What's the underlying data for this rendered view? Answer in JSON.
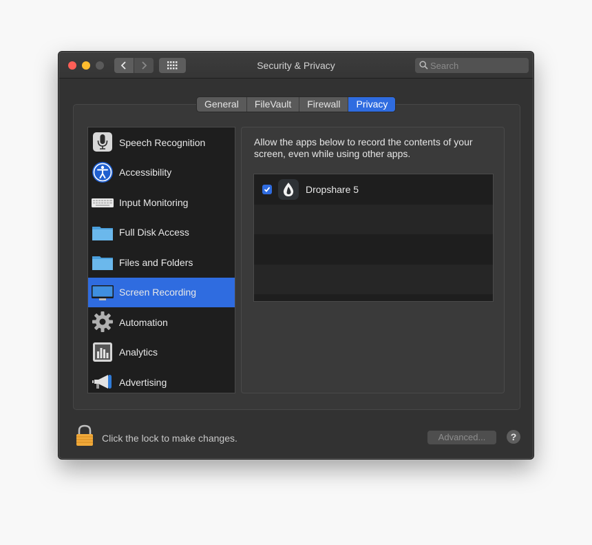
{
  "window": {
    "title": "Security & Privacy"
  },
  "toolbar": {
    "back_icon": "chevron-left-icon",
    "forward_icon": "chevron-right-icon",
    "grid_icon": "show-all-grid-icon"
  },
  "search": {
    "placeholder": "Search",
    "value": ""
  },
  "tabs": [
    {
      "label": "General",
      "active": false
    },
    {
      "label": "FileVault",
      "active": false
    },
    {
      "label": "Firewall",
      "active": false
    },
    {
      "label": "Privacy",
      "active": true
    }
  ],
  "sidebar": {
    "items": [
      {
        "label": "Speech Recognition",
        "icon": "microphone-icon",
        "selected": false
      },
      {
        "label": "Accessibility",
        "icon": "accessibility-icon",
        "selected": false
      },
      {
        "label": "Input Monitoring",
        "icon": "keyboard-icon",
        "selected": false
      },
      {
        "label": "Full Disk Access",
        "icon": "folder-icon",
        "selected": false
      },
      {
        "label": "Files and Folders",
        "icon": "folder-icon",
        "selected": false
      },
      {
        "label": "Screen Recording",
        "icon": "display-icon",
        "selected": true
      },
      {
        "label": "Automation",
        "icon": "gear-icon",
        "selected": false
      },
      {
        "label": "Analytics",
        "icon": "bar-chart-icon",
        "selected": false
      },
      {
        "label": "Advertising",
        "icon": "megaphone-icon",
        "selected": false
      }
    ]
  },
  "content": {
    "description": "Allow the apps below to record the contents of your screen, even while using other apps.",
    "apps": [
      {
        "name": "Dropshare 5",
        "checked": true,
        "icon": "dropshare-icon"
      }
    ]
  },
  "footer": {
    "lock_text": "Click the lock to make changes.",
    "advanced_label": "Advanced...",
    "help_label": "?"
  },
  "colors": {
    "accent": "#2f6ce0",
    "window_bg": "#323232",
    "close": "#fe5f57",
    "minimize": "#febc2e"
  }
}
